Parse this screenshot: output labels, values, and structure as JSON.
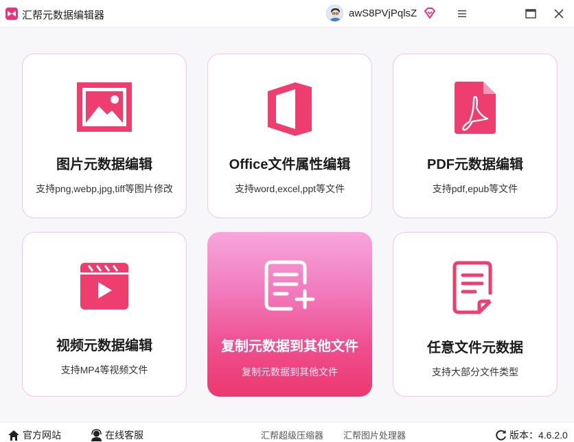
{
  "app": {
    "title": "汇帮元数据编辑器",
    "username": "awS8PVjPqlsZ",
    "accent": "#e8347a"
  },
  "cards": [
    {
      "title": "图片元数据编辑",
      "desc": "支持png,webp,jpg,tiff等图片修改",
      "icon": "image-icon"
    },
    {
      "title": "Office文件属性编辑",
      "desc": "支持word,excel,ppt等文件",
      "icon": "office-icon"
    },
    {
      "title": "PDF元数据编辑",
      "desc": "支持pdf,epub等文件",
      "icon": "pdf-icon"
    },
    {
      "title": "视频元数据编辑",
      "desc": "支持MP4等视频文件",
      "icon": "video-icon"
    },
    {
      "title": "复制元数据到其他文件",
      "desc": "复制元数据到其他文件",
      "icon": "copy-document-icon",
      "active": true
    },
    {
      "title": "任意文件元数据",
      "desc": "支持大部分文件类型",
      "icon": "document-icon"
    }
  ],
  "footer": {
    "website": "官方网站",
    "support": "在线客服",
    "link1": "汇帮超级压缩器",
    "link2": "汇帮图片处理器",
    "version_label": "版本：",
    "version": "4.6.2.0"
  }
}
